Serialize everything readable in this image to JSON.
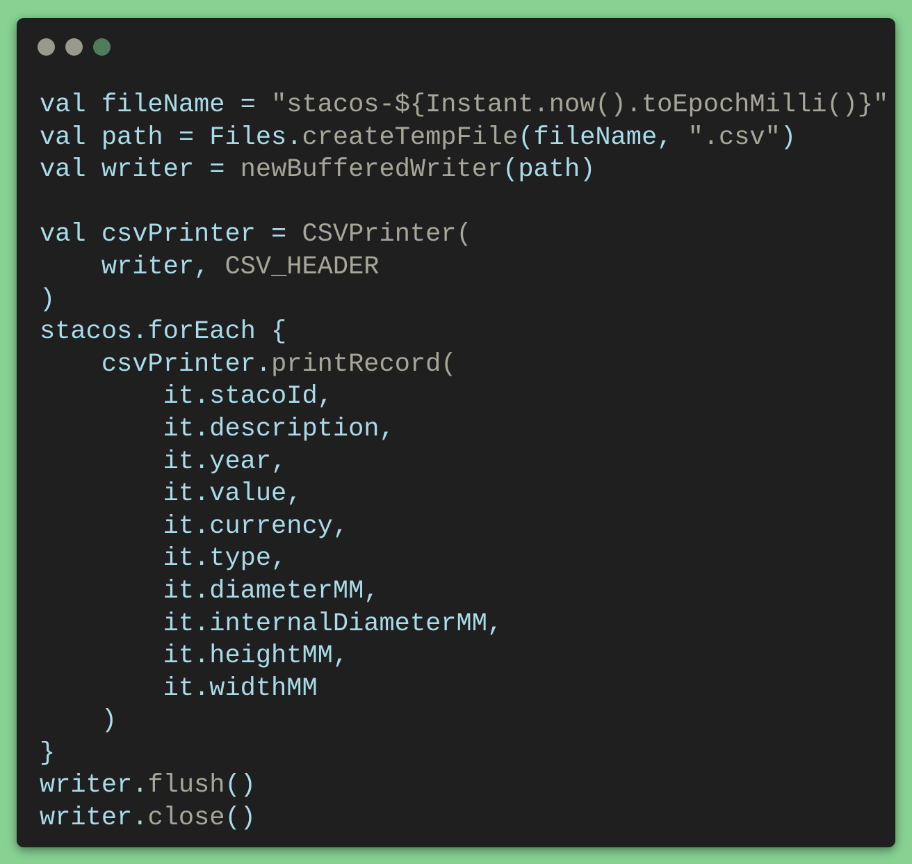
{
  "window": {
    "controls": [
      {
        "name": "close-dot",
        "color": "#9a9a8c"
      },
      {
        "name": "minimize-dot",
        "color": "#9a9a8c"
      },
      {
        "name": "maximize-dot",
        "color": "#4e7d5d"
      }
    ]
  },
  "colors": {
    "identifier": "#a9dbe8",
    "call": "#a7a699",
    "background": "#1f1f1f",
    "page": "#87d193"
  },
  "code_lines": [
    [
      [
        "val fileName = ",
        "id"
      ],
      [
        "\"stacos-${Instant.now().toEpochMilli()}\"",
        "fn"
      ]
    ],
    [
      [
        "val path = Files.",
        "id"
      ],
      [
        "createTempFile",
        "fn"
      ],
      [
        "(fileName, ",
        "id"
      ],
      [
        "\".csv\"",
        "fn"
      ],
      [
        ")",
        "id"
      ]
    ],
    [
      [
        "val writer = ",
        "id"
      ],
      [
        "newBufferedWriter",
        "fn"
      ],
      [
        "(path)",
        "id"
      ]
    ],
    [],
    [
      [
        "val csvPrinter = ",
        "id"
      ],
      [
        "CSVPrinter(",
        "fn"
      ]
    ],
    [
      [
        "    writer, ",
        "id"
      ],
      [
        "CSV_HEADER",
        "fn"
      ]
    ],
    [
      [
        ")",
        "id"
      ]
    ],
    [
      [
        "stacos.forEach {",
        "id"
      ]
    ],
    [
      [
        "    csvPrinter.",
        "id"
      ],
      [
        "printRecord(",
        "fn"
      ]
    ],
    [
      [
        "        it.stacoId,",
        "id"
      ]
    ],
    [
      [
        "        it.description,",
        "id"
      ]
    ],
    [
      [
        "        it.year,",
        "id"
      ]
    ],
    [
      [
        "        it.value,",
        "id"
      ]
    ],
    [
      [
        "        it.currency,",
        "id"
      ]
    ],
    [
      [
        "        it.type,",
        "id"
      ]
    ],
    [
      [
        "        it.diameterMM,",
        "id"
      ]
    ],
    [
      [
        "        it.internalDiameterMM,",
        "id"
      ]
    ],
    [
      [
        "        it.heightMM,",
        "id"
      ]
    ],
    [
      [
        "        it.widthMM",
        "id"
      ]
    ],
    [
      [
        "    )",
        "id"
      ]
    ],
    [
      [
        "}",
        "id"
      ]
    ],
    [
      [
        "writer.",
        "id"
      ],
      [
        "flush",
        "fn"
      ],
      [
        "()",
        "id"
      ]
    ],
    [
      [
        "writer.",
        "id"
      ],
      [
        "close",
        "fn"
      ],
      [
        "()",
        "id"
      ]
    ]
  ]
}
